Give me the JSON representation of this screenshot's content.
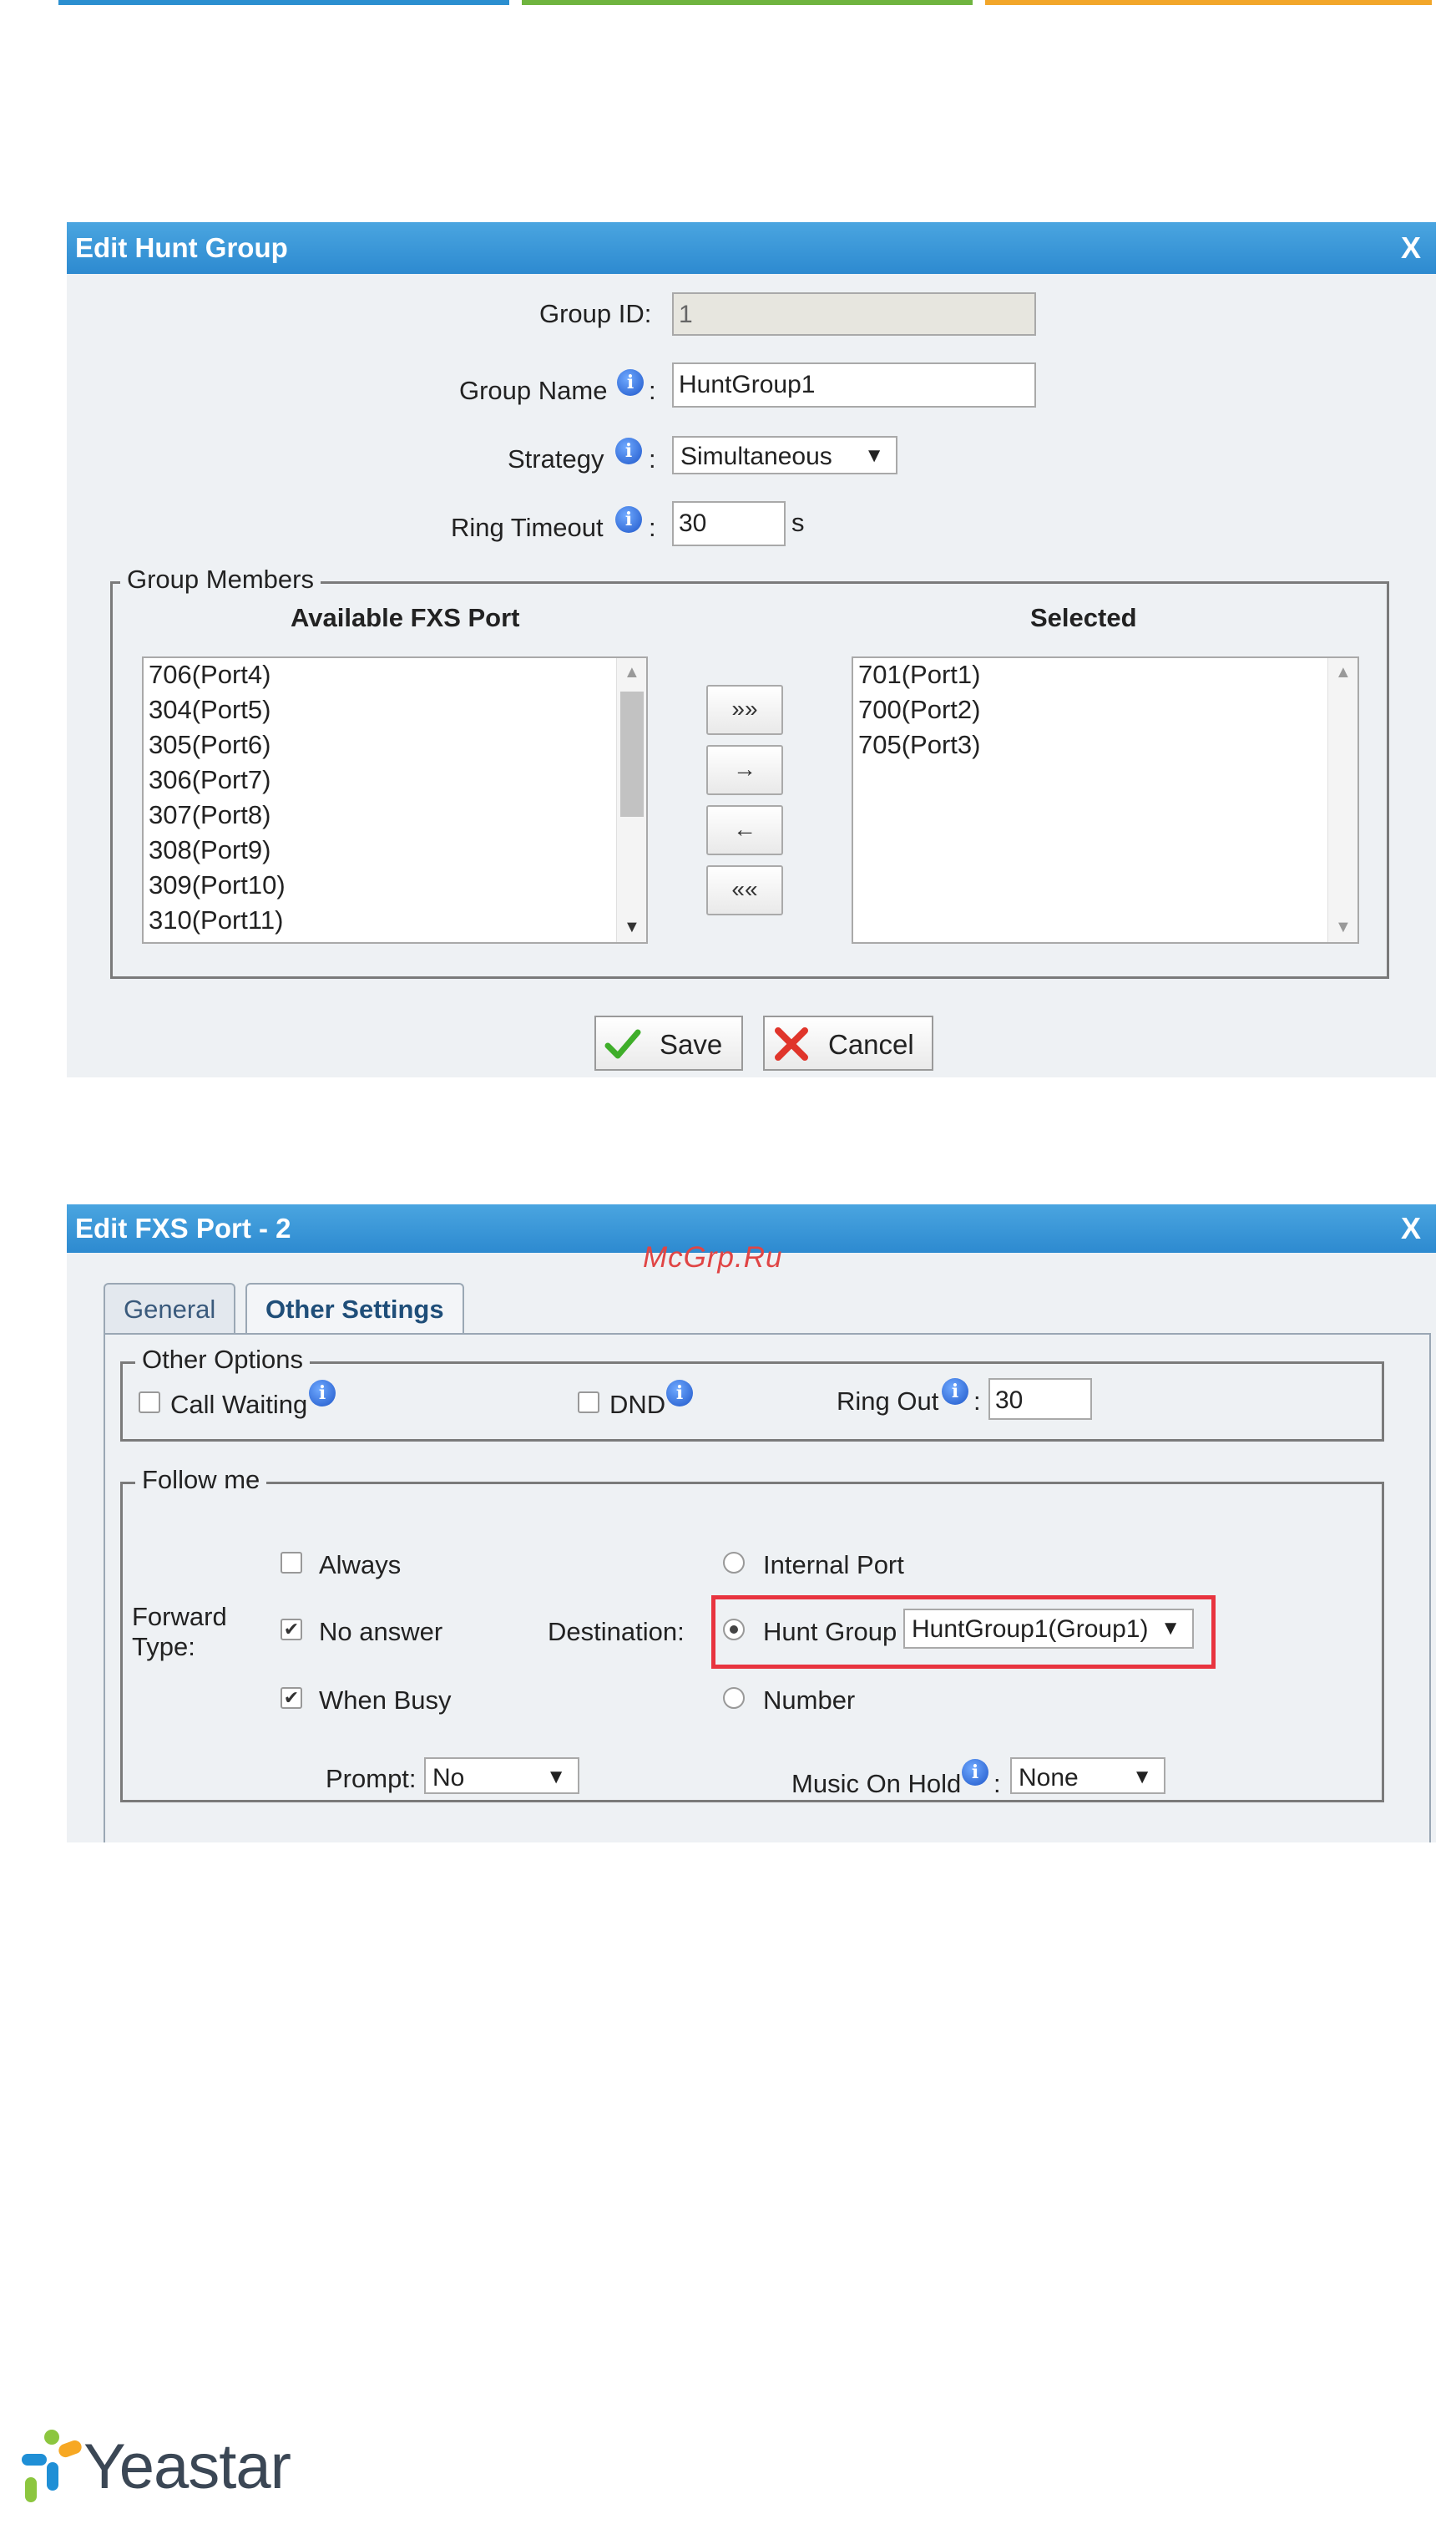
{
  "colors": {
    "titlebar": "#2d8ad0",
    "highlight": "#e8343f",
    "watermark": "#e04545"
  },
  "hunt_group_dialog": {
    "title": "Edit Hunt Group",
    "close": "X",
    "group_id_label": "Group ID:",
    "group_id_value": "1",
    "group_name_label": "Group Name",
    "group_name_value": "HuntGroup1",
    "strategy_label": "Strategy",
    "strategy_value": "Simultaneous",
    "ring_timeout_label": "Ring Timeout",
    "ring_timeout_value": "30",
    "ring_timeout_unit": "s",
    "colon": ":",
    "group_members_legend": "Group Members",
    "available_header": "Available FXS Port",
    "selected_header": "Selected",
    "available_items": [
      "706(Port4)",
      "304(Port5)",
      "305(Port6)",
      "306(Port7)",
      "307(Port8)",
      "308(Port9)",
      "309(Port10)",
      "310(Port11)"
    ],
    "selected_items": [
      "701(Port1)",
      "700(Port2)",
      "705(Port3)"
    ],
    "move_buttons": [
      "»»",
      "→",
      "←",
      "««"
    ],
    "save_label": "Save",
    "cancel_label": "Cancel",
    "icons": {
      "save": "check-icon",
      "cancel": "x-mark-icon",
      "info": "info-icon"
    }
  },
  "fxs_port_dialog": {
    "title": "Edit FXS Port - 2",
    "close": "X",
    "watermark": "McGrp.Ru",
    "tabs": [
      {
        "label": "General",
        "active": false
      },
      {
        "label": "Other Settings",
        "active": true
      }
    ],
    "other_options_legend": "Other Options",
    "call_waiting_label": "Call Waiting",
    "dnd_label": "DND",
    "ring_out_label": "Ring Out",
    "ring_out_value": "30",
    "colon": ":",
    "follow_me_legend": "Follow me",
    "forward_type_label": "Forward Type:",
    "always_label": "Always",
    "no_answer_label": "No answer",
    "when_busy_label": "When Busy",
    "destination_label": "Destination:",
    "internal_port_label": "Internal Port",
    "hunt_group_label": "Hunt Group",
    "hunt_group_value": "HuntGroup1(Group1)",
    "number_label": "Number",
    "prompt_label": "Prompt:",
    "prompt_value": "No",
    "moh_label": "Music On Hold",
    "moh_value": "None",
    "checks": {
      "call_waiting": false,
      "dnd": false,
      "always": false,
      "no_answer": true,
      "when_busy": true
    },
    "destination_selected": "hunt_group"
  },
  "logo": {
    "text": "Yeastar"
  }
}
